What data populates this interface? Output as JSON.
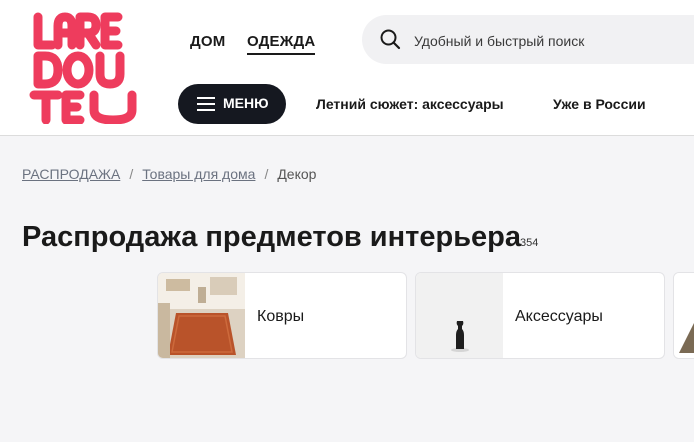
{
  "header": {
    "logo_text": [
      "LARE",
      "DOU",
      "TE"
    ],
    "top_tabs": [
      {
        "label": "ДОМ"
      },
      {
        "label": "ОДЕЖДА"
      }
    ],
    "search": {
      "placeholder": "Удобный и быстрый поиск",
      "icon": "search-icon"
    },
    "menu_button": {
      "label": "МЕНЮ",
      "icon": "hamburger-icon"
    },
    "nav_links": [
      {
        "label": "Летний сюжет: аксессуары"
      },
      {
        "label": "Уже в России"
      }
    ]
  },
  "breadcrumb": {
    "items": [
      {
        "label": "РАСПРОДАЖА"
      },
      {
        "label": "Товары для дома"
      }
    ],
    "separator": "/",
    "current": "Декор"
  },
  "main": {
    "title": "Распродажа предметов интерьера",
    "count": "354",
    "categories": [
      {
        "label": "Ковры"
      },
      {
        "label": "Аксессуары"
      }
    ]
  },
  "colors": {
    "brand": "#ee3c5d",
    "dark_button": "#151820",
    "page_bg": "#f5f5f7"
  }
}
